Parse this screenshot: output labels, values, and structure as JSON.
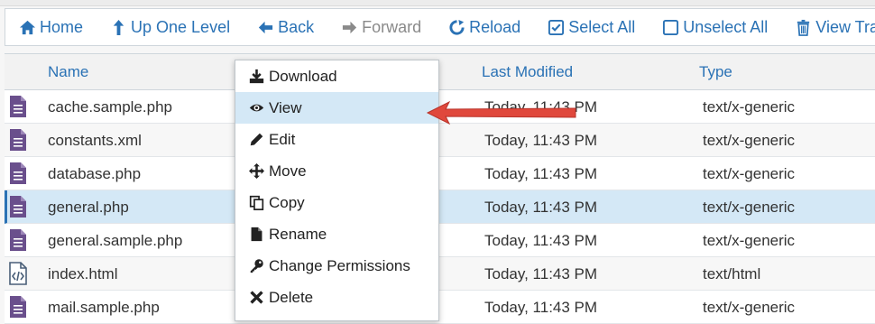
{
  "toolbar": {
    "home": "Home",
    "up_one_level": "Up One Level",
    "back": "Back",
    "forward": "Forward",
    "reload": "Reload",
    "select_all": "Select All",
    "unselect_all": "Unselect All",
    "view_trash": "View Trash"
  },
  "table": {
    "columns": {
      "name": "Name",
      "last_modified": "Last Modified",
      "type": "Type"
    },
    "rows": [
      {
        "name": "cache.sample.php",
        "modified": "Today, 11:43 PM",
        "type": "text/x-generic",
        "icon": "php-file-icon"
      },
      {
        "name": "constants.xml",
        "modified": "Today, 11:43 PM",
        "type": "text/x-generic",
        "icon": "generic-file-icon"
      },
      {
        "name": "database.php",
        "modified": "Today, 11:43 PM",
        "type": "text/x-generic",
        "icon": "php-file-icon"
      },
      {
        "name": "general.php",
        "modified": "Today, 11:43 PM",
        "type": "text/x-generic",
        "icon": "php-file-icon",
        "selected": true
      },
      {
        "name": "general.sample.php",
        "modified": "Today, 11:43 PM",
        "type": "text/x-generic",
        "icon": "php-file-icon"
      },
      {
        "name": "index.html",
        "modified": "Today, 11:43 PM",
        "type": "text/html",
        "icon": "html-file-icon"
      },
      {
        "name": "mail.sample.php",
        "modified": "Today, 11:43 PM",
        "type": "text/x-generic",
        "icon": "php-file-icon"
      }
    ]
  },
  "context_menu": {
    "download": "Download",
    "view": "View",
    "edit": "Edit",
    "move": "Move",
    "copy": "Copy",
    "rename": "Rename",
    "change_permissions": "Change Permissions",
    "delete": "Delete"
  },
  "colors": {
    "accent": "#2a72b5",
    "file_icon": "#6a4f8c",
    "highlight": "#d4e8f6",
    "annotation_arrow": "#e0483c"
  }
}
